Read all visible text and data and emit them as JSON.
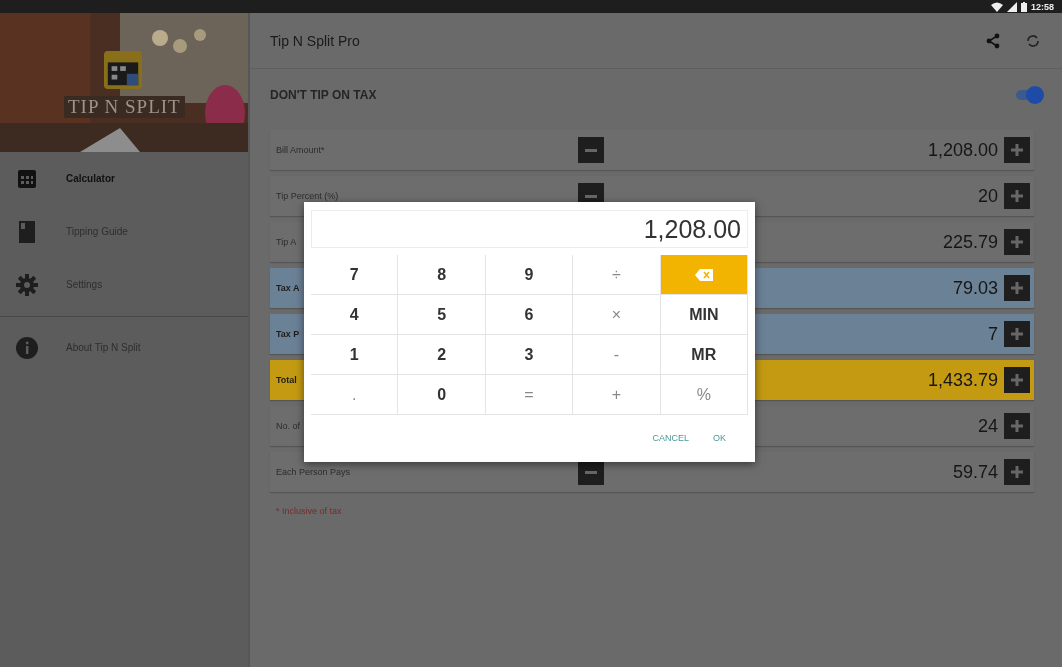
{
  "status_bar": {
    "time": "12:58"
  },
  "drawer": {
    "logo_text": "TIP N SPLIT",
    "sections": [
      [
        {
          "label": "Calculator",
          "kind": "calculator",
          "selected": true
        },
        {
          "label": "Tipping Guide",
          "kind": "book",
          "selected": false
        },
        {
          "label": "Settings",
          "kind": "gear",
          "selected": false
        }
      ],
      [
        {
          "label": "About Tip N Split",
          "kind": "info",
          "selected": false
        }
      ]
    ]
  },
  "app_bar": {
    "title": "Tip N Split Pro"
  },
  "tax_toggle": {
    "label": "DON'T TIP ON TAX",
    "on": true
  },
  "rows": [
    {
      "label": "Bill Amount*",
      "value": "1,208.00",
      "kind": "plain",
      "minus": true
    },
    {
      "label": "Tip Percent (%)",
      "value": "20",
      "kind": "plain",
      "minus": true
    },
    {
      "label": "Tip A",
      "value": "225.79",
      "kind": "plain"
    },
    {
      "label": "Tax A",
      "value": "79.03",
      "kind": "tax"
    },
    {
      "label": "Tax P",
      "value": "7",
      "kind": "tax"
    },
    {
      "label": "Total",
      "value": "1,433.79",
      "kind": "total"
    },
    {
      "label": "No. of",
      "value": "24",
      "kind": "plain"
    },
    {
      "label": "Each Person Pays",
      "value": "59.74",
      "kind": "plain",
      "minus": true
    }
  ],
  "footnote": "* Inclusive of tax",
  "dialog": {
    "display": "1,208.00",
    "keys": [
      {
        "label": "7",
        "kind": "digit"
      },
      {
        "label": "8",
        "kind": "digit"
      },
      {
        "label": "9",
        "kind": "digit"
      },
      {
        "label": "÷",
        "kind": "op"
      },
      {
        "kind": "backspace"
      },
      {
        "label": "4",
        "kind": "digit"
      },
      {
        "label": "5",
        "kind": "digit"
      },
      {
        "label": "6",
        "kind": "digit"
      },
      {
        "label": "×",
        "kind": "op"
      },
      {
        "label": "MIN",
        "kind": "digit"
      },
      {
        "label": "1",
        "kind": "digit"
      },
      {
        "label": "2",
        "kind": "digit"
      },
      {
        "label": "3",
        "kind": "digit"
      },
      {
        "label": "-",
        "kind": "op"
      },
      {
        "label": "MR",
        "kind": "digit"
      },
      {
        "label": ".",
        "kind": "op"
      },
      {
        "label": "0",
        "kind": "digit"
      },
      {
        "label": "=",
        "kind": "op"
      },
      {
        "label": "+",
        "kind": "op"
      },
      {
        "label": "%",
        "kind": "op"
      }
    ],
    "buttons": [
      "CANCEL",
      "OK"
    ]
  }
}
